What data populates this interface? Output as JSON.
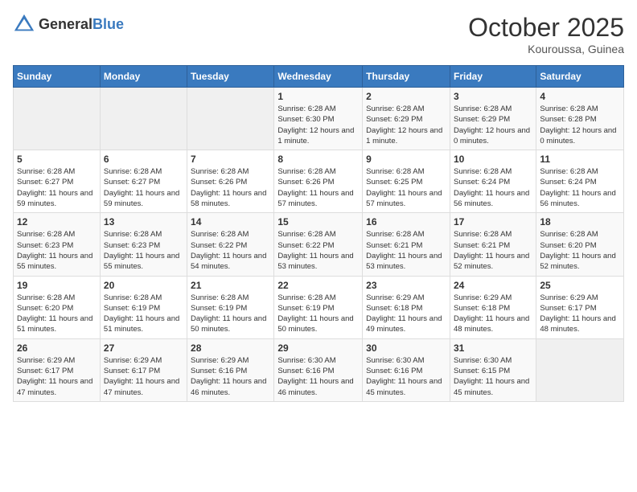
{
  "header": {
    "logo_general": "General",
    "logo_blue": "Blue",
    "month": "October 2025",
    "location": "Kouroussa, Guinea"
  },
  "days_of_week": [
    "Sunday",
    "Monday",
    "Tuesday",
    "Wednesday",
    "Thursday",
    "Friday",
    "Saturday"
  ],
  "weeks": [
    [
      {
        "day": "",
        "info": ""
      },
      {
        "day": "",
        "info": ""
      },
      {
        "day": "",
        "info": ""
      },
      {
        "day": "1",
        "info": "Sunrise: 6:28 AM\nSunset: 6:30 PM\nDaylight: 12 hours and 1 minute."
      },
      {
        "day": "2",
        "info": "Sunrise: 6:28 AM\nSunset: 6:29 PM\nDaylight: 12 hours and 1 minute."
      },
      {
        "day": "3",
        "info": "Sunrise: 6:28 AM\nSunset: 6:29 PM\nDaylight: 12 hours and 0 minutes."
      },
      {
        "day": "4",
        "info": "Sunrise: 6:28 AM\nSunset: 6:28 PM\nDaylight: 12 hours and 0 minutes."
      }
    ],
    [
      {
        "day": "5",
        "info": "Sunrise: 6:28 AM\nSunset: 6:27 PM\nDaylight: 11 hours and 59 minutes."
      },
      {
        "day": "6",
        "info": "Sunrise: 6:28 AM\nSunset: 6:27 PM\nDaylight: 11 hours and 59 minutes."
      },
      {
        "day": "7",
        "info": "Sunrise: 6:28 AM\nSunset: 6:26 PM\nDaylight: 11 hours and 58 minutes."
      },
      {
        "day": "8",
        "info": "Sunrise: 6:28 AM\nSunset: 6:26 PM\nDaylight: 11 hours and 57 minutes."
      },
      {
        "day": "9",
        "info": "Sunrise: 6:28 AM\nSunset: 6:25 PM\nDaylight: 11 hours and 57 minutes."
      },
      {
        "day": "10",
        "info": "Sunrise: 6:28 AM\nSunset: 6:24 PM\nDaylight: 11 hours and 56 minutes."
      },
      {
        "day": "11",
        "info": "Sunrise: 6:28 AM\nSunset: 6:24 PM\nDaylight: 11 hours and 56 minutes."
      }
    ],
    [
      {
        "day": "12",
        "info": "Sunrise: 6:28 AM\nSunset: 6:23 PM\nDaylight: 11 hours and 55 minutes."
      },
      {
        "day": "13",
        "info": "Sunrise: 6:28 AM\nSunset: 6:23 PM\nDaylight: 11 hours and 55 minutes."
      },
      {
        "day": "14",
        "info": "Sunrise: 6:28 AM\nSunset: 6:22 PM\nDaylight: 11 hours and 54 minutes."
      },
      {
        "day": "15",
        "info": "Sunrise: 6:28 AM\nSunset: 6:22 PM\nDaylight: 11 hours and 53 minutes."
      },
      {
        "day": "16",
        "info": "Sunrise: 6:28 AM\nSunset: 6:21 PM\nDaylight: 11 hours and 53 minutes."
      },
      {
        "day": "17",
        "info": "Sunrise: 6:28 AM\nSunset: 6:21 PM\nDaylight: 11 hours and 52 minutes."
      },
      {
        "day": "18",
        "info": "Sunrise: 6:28 AM\nSunset: 6:20 PM\nDaylight: 11 hours and 52 minutes."
      }
    ],
    [
      {
        "day": "19",
        "info": "Sunrise: 6:28 AM\nSunset: 6:20 PM\nDaylight: 11 hours and 51 minutes."
      },
      {
        "day": "20",
        "info": "Sunrise: 6:28 AM\nSunset: 6:19 PM\nDaylight: 11 hours and 51 minutes."
      },
      {
        "day": "21",
        "info": "Sunrise: 6:28 AM\nSunset: 6:19 PM\nDaylight: 11 hours and 50 minutes."
      },
      {
        "day": "22",
        "info": "Sunrise: 6:28 AM\nSunset: 6:19 PM\nDaylight: 11 hours and 50 minutes."
      },
      {
        "day": "23",
        "info": "Sunrise: 6:29 AM\nSunset: 6:18 PM\nDaylight: 11 hours and 49 minutes."
      },
      {
        "day": "24",
        "info": "Sunrise: 6:29 AM\nSunset: 6:18 PM\nDaylight: 11 hours and 48 minutes."
      },
      {
        "day": "25",
        "info": "Sunrise: 6:29 AM\nSunset: 6:17 PM\nDaylight: 11 hours and 48 minutes."
      }
    ],
    [
      {
        "day": "26",
        "info": "Sunrise: 6:29 AM\nSunset: 6:17 PM\nDaylight: 11 hours and 47 minutes."
      },
      {
        "day": "27",
        "info": "Sunrise: 6:29 AM\nSunset: 6:17 PM\nDaylight: 11 hours and 47 minutes."
      },
      {
        "day": "28",
        "info": "Sunrise: 6:29 AM\nSunset: 6:16 PM\nDaylight: 11 hours and 46 minutes."
      },
      {
        "day": "29",
        "info": "Sunrise: 6:30 AM\nSunset: 6:16 PM\nDaylight: 11 hours and 46 minutes."
      },
      {
        "day": "30",
        "info": "Sunrise: 6:30 AM\nSunset: 6:16 PM\nDaylight: 11 hours and 45 minutes."
      },
      {
        "day": "31",
        "info": "Sunrise: 6:30 AM\nSunset: 6:15 PM\nDaylight: 11 hours and 45 minutes."
      },
      {
        "day": "",
        "info": ""
      }
    ]
  ]
}
